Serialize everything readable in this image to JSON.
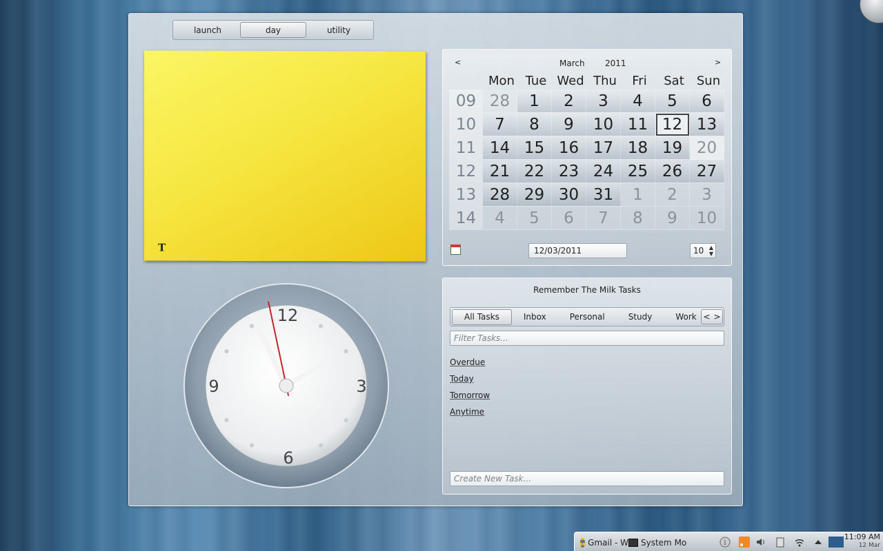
{
  "activity_tabs": [
    "launch",
    "day",
    "utility"
  ],
  "active_activity": "day",
  "note": {
    "format_icon": "text-format-icon",
    "format_glyph": "T",
    "color": "#f6e640"
  },
  "calendar": {
    "prev_label": "<",
    "next_label": ">",
    "month": "March",
    "year": "2011",
    "weekdays": [
      "Mon",
      "Tue",
      "Wed",
      "Thu",
      "Fri",
      "Sat",
      "Sun"
    ],
    "weeks": [
      {
        "num": "09",
        "days": [
          {
            "d": "28",
            "o": true
          },
          {
            "d": "1"
          },
          {
            "d": "2"
          },
          {
            "d": "3"
          },
          {
            "d": "4"
          },
          {
            "d": "5"
          },
          {
            "d": "6"
          }
        ]
      },
      {
        "num": "10",
        "days": [
          {
            "d": "7"
          },
          {
            "d": "8"
          },
          {
            "d": "9"
          },
          {
            "d": "10"
          },
          {
            "d": "11"
          },
          {
            "d": "12",
            "today": true
          },
          {
            "d": "13"
          }
        ]
      },
      {
        "num": "11",
        "days": [
          {
            "d": "14"
          },
          {
            "d": "15"
          },
          {
            "d": "16"
          },
          {
            "d": "17"
          },
          {
            "d": "18"
          },
          {
            "d": "19"
          },
          {
            "d": "20",
            "hi": true
          }
        ]
      },
      {
        "num": "12",
        "days": [
          {
            "d": "21"
          },
          {
            "d": "22"
          },
          {
            "d": "23"
          },
          {
            "d": "24"
          },
          {
            "d": "25"
          },
          {
            "d": "26"
          },
          {
            "d": "27"
          }
        ]
      },
      {
        "num": "13",
        "days": [
          {
            "d": "28"
          },
          {
            "d": "29"
          },
          {
            "d": "30"
          },
          {
            "d": "31"
          },
          {
            "d": "1",
            "o": true
          },
          {
            "d": "2",
            "o": true
          },
          {
            "d": "3",
            "o": true
          }
        ]
      },
      {
        "num": "14",
        "days": [
          {
            "d": "4",
            "o": true
          },
          {
            "d": "5",
            "o": true
          },
          {
            "d": "6",
            "o": true
          },
          {
            "d": "7",
            "o": true
          },
          {
            "d": "8",
            "o": true
          },
          {
            "d": "9",
            "o": true
          },
          {
            "d": "10",
            "o": true
          }
        ]
      }
    ],
    "date_value": "12/03/2011",
    "week_value": "10",
    "today_icon": "calendar-today-icon"
  },
  "clock": {
    "numerals": {
      "twelve": "12",
      "three": "3",
      "six": "6",
      "nine": "9"
    },
    "hour": 11,
    "minute": 9,
    "second": 58
  },
  "rtm": {
    "title": "Remember The Milk Tasks",
    "tabs": [
      "All Tasks",
      "Inbox",
      "Personal",
      "Study",
      "Work"
    ],
    "active_tab": "All Tasks",
    "filter_placeholder": "Filter Tasks...",
    "groups": [
      "Overdue",
      "Today",
      "Tomorrow",
      "Anytime"
    ],
    "create_placeholder": "Create New Task..."
  },
  "taskbar": {
    "tasks": [
      {
        "icon": "chrome-icon",
        "label": "Gmail - W"
      },
      {
        "icon": "system-monitor-icon",
        "label": "System Mo"
      }
    ],
    "tray_icons": [
      "info-icon",
      "rss-icon",
      "volume-icon",
      "clipboard-icon",
      "wifi-icon",
      "expand-tray-icon",
      "desktop-icon"
    ],
    "time": "11:09 AM",
    "date": "12 Mar"
  }
}
